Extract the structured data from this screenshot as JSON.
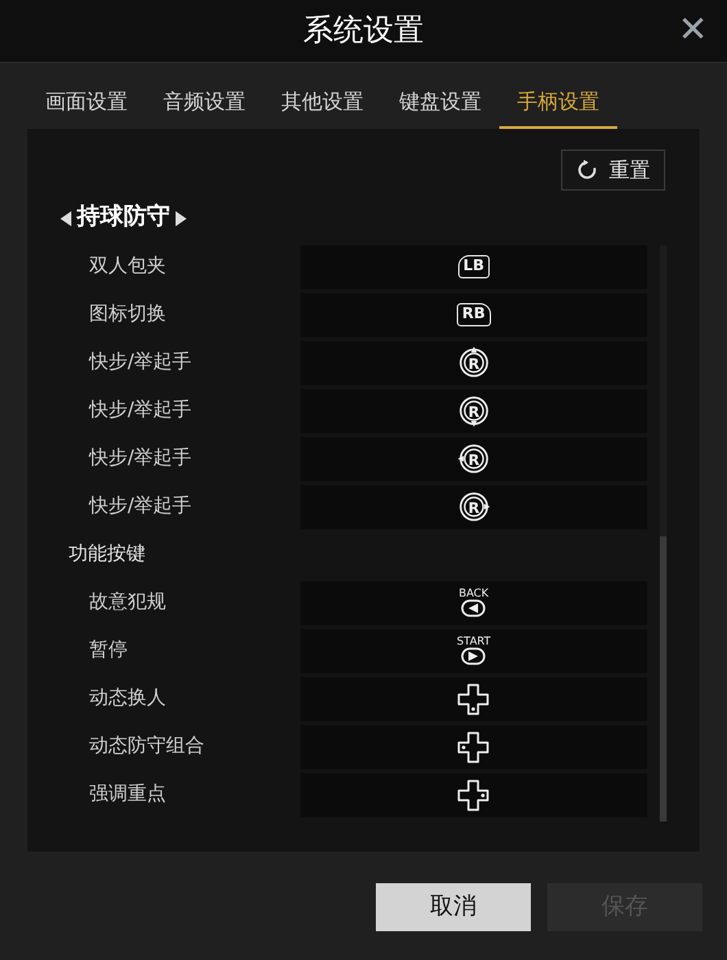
{
  "window": {
    "title": "系统设置",
    "close": "✕"
  },
  "tabs": [
    {
      "label": "画面设置",
      "selected": false
    },
    {
      "label": "音频设置",
      "selected": false
    },
    {
      "label": "其他设置",
      "selected": false
    },
    {
      "label": "键盘设置",
      "selected": false
    },
    {
      "label": "手柄设置",
      "selected": true
    }
  ],
  "reset_button": "重置",
  "sections": [
    {
      "title": "持球防守",
      "kind": "selector",
      "rows": [
        {
          "label": "双人包夹",
          "kind": "bumper-left",
          "key": "LB"
        },
        {
          "label": "图标切换",
          "kind": "bumper-right",
          "key": "RB"
        },
        {
          "label": "快步/举起手",
          "kind": "stick-up",
          "key": "R"
        },
        {
          "label": "快步/举起手",
          "kind": "stick-down",
          "key": "R"
        },
        {
          "label": "快步/举起手",
          "kind": "stick-left",
          "key": "R"
        },
        {
          "label": "快步/举起手",
          "kind": "stick-right",
          "key": "R"
        }
      ]
    },
    {
      "title": "功能按键",
      "kind": "plain",
      "rows": [
        {
          "label": "故意犯规",
          "kind": "menu-left",
          "key": "BACK"
        },
        {
          "label": "暂停",
          "kind": "menu-right",
          "key": "START"
        },
        {
          "label": "动态换人",
          "kind": "dpad-down"
        },
        {
          "label": "动态防守组合",
          "kind": "dpad-left"
        },
        {
          "label": "强调重点",
          "kind": "dpad-right"
        }
      ]
    }
  ],
  "buttons": [
    {
      "label": "取消",
      "disabled": false
    },
    {
      "label": "保存",
      "disabled": true
    }
  ]
}
